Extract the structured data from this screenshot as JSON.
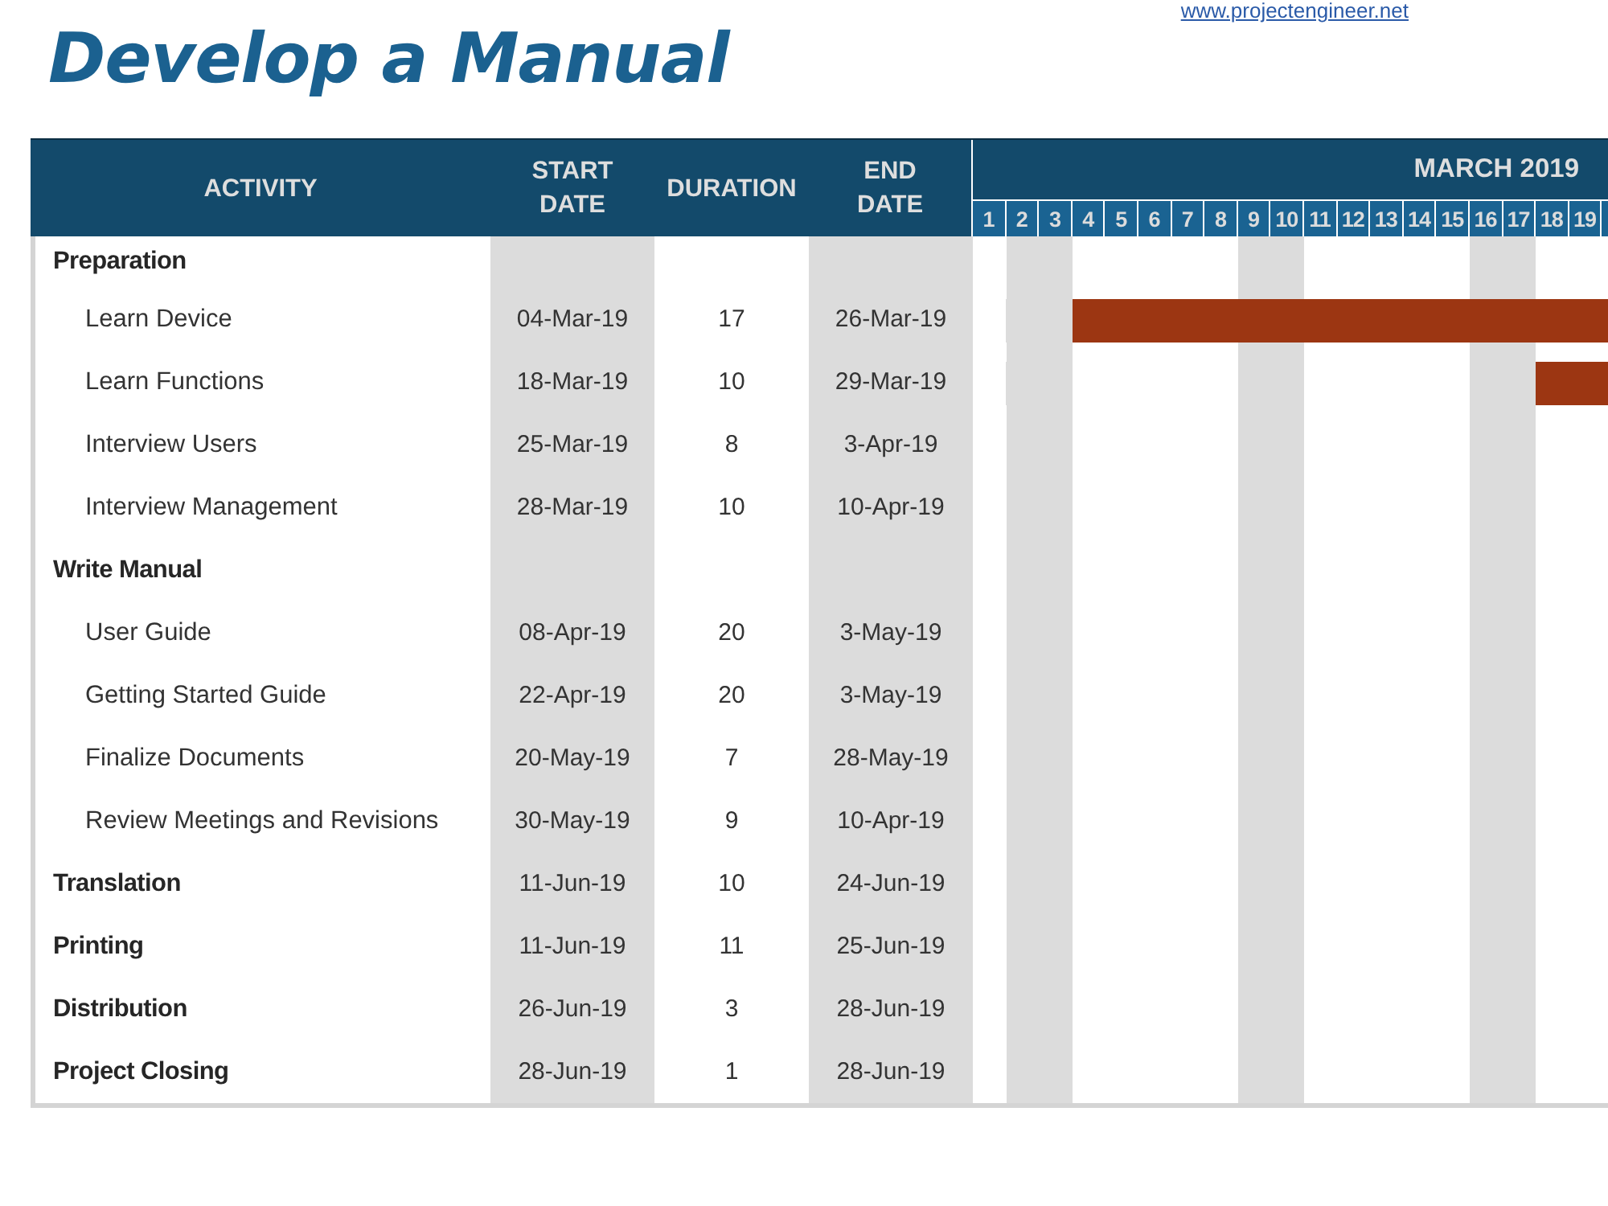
{
  "title": "Develop a Manual",
  "link": "www.projectengineer.net",
  "table": {
    "columns": [
      {
        "label": "ACTIVITY"
      },
      {
        "label": "START DATE"
      },
      {
        "label": "DURATION"
      },
      {
        "label": "END DATE"
      }
    ],
    "rows": [
      {
        "kind": "group",
        "activity": "Preparation"
      },
      {
        "kind": "task",
        "activity": "Learn Device",
        "start": "04-Mar-19",
        "duration": "17",
        "end": "26-Mar-19",
        "level": 0.844
      },
      {
        "kind": "task",
        "activity": "Learn Functions",
        "start": "18-Mar-19",
        "duration": "10",
        "end": "29-Mar-19",
        "level": 0.113
      },
      {
        "kind": "task",
        "activity": "Interview Users",
        "start": "25-Mar-19",
        "duration": "8",
        "end": "3-Apr-19"
      },
      {
        "kind": "task",
        "activity": "Interview Management",
        "start": "28-Mar-19",
        "duration": "10",
        "end": "10-Apr-19"
      },
      {
        "kind": "group",
        "activity": "Write Manual"
      },
      {
        "kind": "task",
        "activity": "User Guide",
        "start": "08-Apr-19",
        "duration": "20",
        "end": "3-May-19"
      },
      {
        "kind": "task",
        "activity": "Getting Started Guide",
        "start": "22-Apr-19",
        "duration": "20",
        "end": "3-May-19"
      },
      {
        "kind": "task",
        "activity": "Finalize Documents",
        "start": "20-May-19",
        "duration": "7",
        "end": "28-May-19"
      },
      {
        "kind": "task",
        "activity": "Review Meetings and Revisions",
        "start": "30-May-19",
        "duration": "9",
        "end": "10-Apr-19"
      },
      {
        "kind": "group",
        "activity": "Translation",
        "start": "11-Jun-19",
        "duration": "10",
        "end": "24-Jun-19"
      },
      {
        "kind": "group",
        "activity": "Printing",
        "start": "11-Jun-19",
        "duration": "11",
        "end": "25-Jun-19"
      },
      {
        "kind": "group",
        "activity": "Distribution",
        "start": "26-Jun-19",
        "duration": "3",
        "end": "28-Jun-19"
      },
      {
        "kind": "group",
        "activity": "Project Closing",
        "start": "28-Jun-19",
        "duration": "1",
        "end": "28-Jun-19"
      }
    ]
  },
  "gantt": {
    "month": "MARCH 2019",
    "days": [
      {
        "label": "1",
        "shaded": false
      },
      {
        "label": "2",
        "shaded": true
      },
      {
        "label": "3",
        "shaded": true
      },
      {
        "label": "4",
        "shaded": false
      },
      {
        "label": "5",
        "shaded": false
      },
      {
        "label": "6",
        "shaded": false
      },
      {
        "label": "7",
        "shaded": false
      },
      {
        "label": "8",
        "shaded": false
      },
      {
        "label": "9",
        "shaded": true
      },
      {
        "label": "10",
        "shaded": true
      },
      {
        "label": "11",
        "shaded": false
      },
      {
        "label": "12",
        "shaded": false
      },
      {
        "label": "13",
        "shaded": false
      },
      {
        "label": "14",
        "shaded": false
      },
      {
        "label": "15",
        "shaded": false
      },
      {
        "label": "16",
        "shaded": true
      },
      {
        "label": "17",
        "shaded": true
      },
      {
        "label": "18",
        "shaded": false
      },
      {
        "label": "19",
        "shaded": false
      }
    ]
  }
}
